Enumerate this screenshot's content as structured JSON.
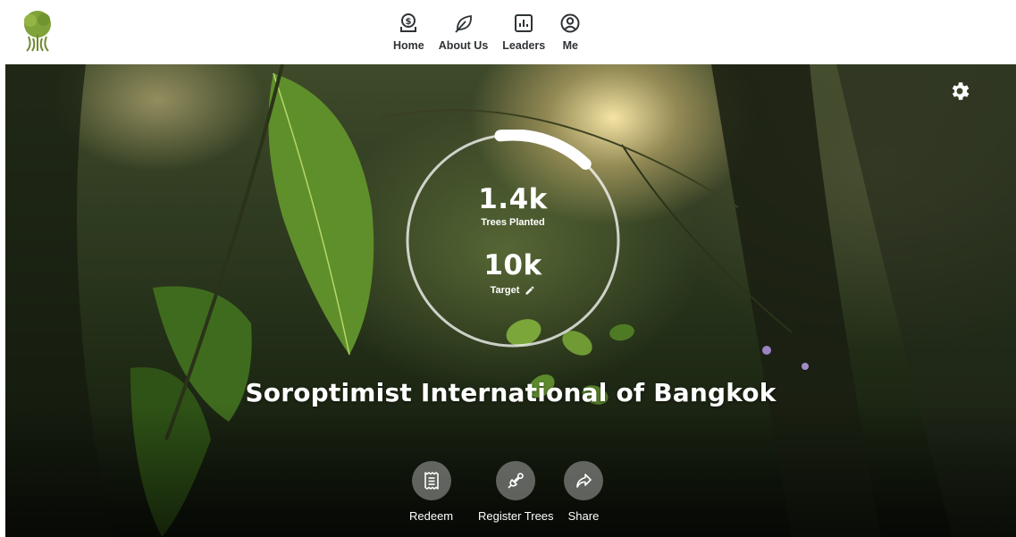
{
  "nav": {
    "items": [
      {
        "label": "Home",
        "icon": "home-coin-icon"
      },
      {
        "label": "About Us",
        "icon": "leaf-icon"
      },
      {
        "label": "Leaders",
        "icon": "leaderboard-icon"
      },
      {
        "label": "Me",
        "icon": "user-icon"
      }
    ]
  },
  "stats": {
    "trees_planted_value": "1.4k",
    "trees_planted_label": "Trees Planted",
    "target_value": "10k",
    "target_label": "Target",
    "progress_fraction": 0.14
  },
  "org": {
    "name": "Soroptimist International of Bangkok"
  },
  "actions": [
    {
      "label": "Redeem",
      "icon": "receipt-icon"
    },
    {
      "label": "Register Trees",
      "icon": "shovel-icon"
    },
    {
      "label": "Share",
      "icon": "share-icon"
    }
  ],
  "colors": {
    "nav_text": "#2f3336",
    "ring": "#ffffff",
    "action_circle": "rgba(200,200,200,0.45)"
  }
}
